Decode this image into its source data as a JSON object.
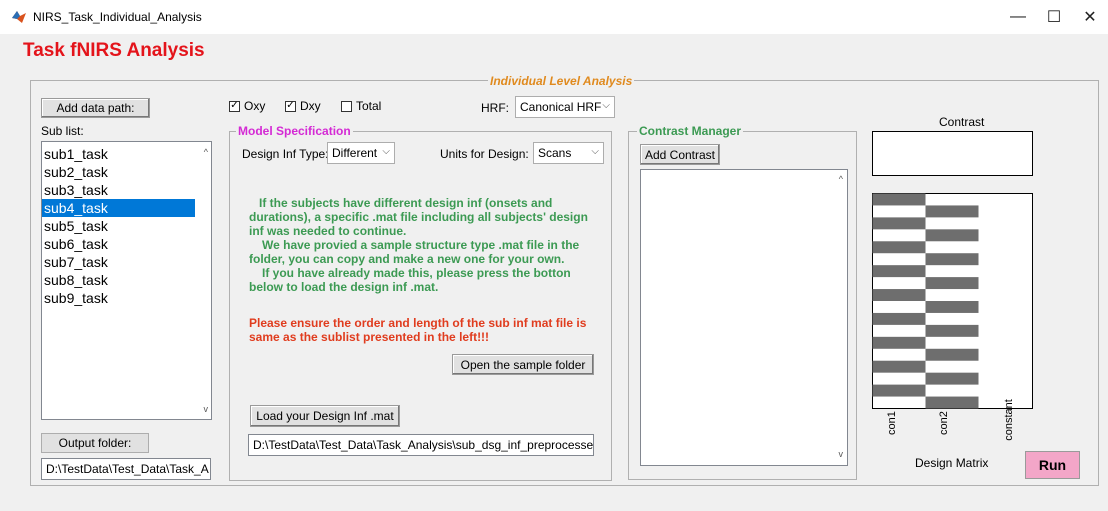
{
  "window": {
    "title": "NIRS_Task_Individual_Analysis",
    "minimize": "—",
    "maximize": "☐",
    "close": "✕"
  },
  "app_title": "Task fNIRS Analysis",
  "individual_panel": {
    "legend": "Individual Level Analysis"
  },
  "left": {
    "add_data_path": "Add data path:",
    "sub_list_label": "Sub list:",
    "subjects": [
      "sub1_task",
      "sub2_task",
      "sub3_task",
      "sub4_task",
      "sub5_task",
      "sub6_task",
      "sub7_task",
      "sub8_task",
      "sub9_task"
    ],
    "selected_index": 3,
    "output_folder_label": "Output folder:",
    "output_folder_value": "D:\\TestData\\Test_Data\\Task_A"
  },
  "signals": {
    "oxy": {
      "label": "Oxy",
      "checked": true
    },
    "dxy": {
      "label": "Dxy",
      "checked": true
    },
    "total": {
      "label": "Total",
      "checked": false
    }
  },
  "hrf": {
    "label": "HRF:",
    "value": "Canonical HRF"
  },
  "model_spec": {
    "legend": "Model Specification",
    "design_inf_type_label": "Design Inf Type:",
    "design_inf_type_value": "Different",
    "units_label": "Units for Design:",
    "units_value": "Scans",
    "green_lines": [
      "If the subjects have different design inf (onsets and",
      "durations), a specific .mat file including all subjects' design",
      "inf was needed to continue.",
      "We have provied a sample structure type .mat file in the",
      "folder, you can copy and make a new one for your own.",
      "If you have already made this, please press the botton",
      "below to load the design inf .mat."
    ],
    "red_lines": [
      "Please ensure the order and length of the sub inf mat file is",
      "same as the sublist presented in the left!!!"
    ],
    "open_sample_folder": "Open the sample folder",
    "load_design": "Load your Design Inf .mat",
    "design_path": "D:\\TestData\\Test_Data\\Task_Analysis\\sub_dsg_inf_preprocessed"
  },
  "contrast_manager": {
    "legend": "Contrast Manager",
    "add_contrast": "Add Contrast"
  },
  "design": {
    "contrast_label": "Contrast",
    "matrix_label": "Design Matrix",
    "columns": [
      "con1",
      "con2",
      "constant"
    ],
    "blocks": 9,
    "dark_color": "#6e6e6e"
  },
  "run_button": "Run",
  "colors": {
    "title_red": "#e4141b",
    "legend_orange": "#e08a1e",
    "legend_magenta": "#d42ad4",
    "legend_green": "#3c9a53",
    "run_bg": "#f3a6c8"
  }
}
